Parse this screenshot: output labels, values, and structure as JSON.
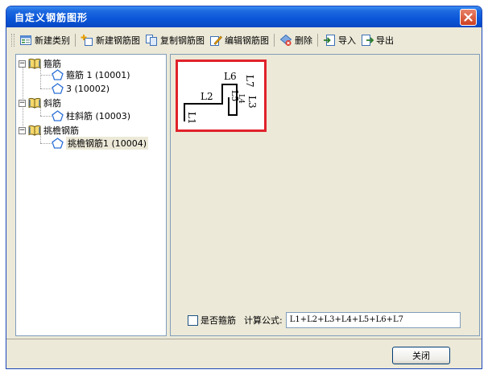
{
  "window": {
    "title": "自定义钢筋图形"
  },
  "toolbar": {
    "new_category": "新建类别",
    "new_figure": "新建钢筋图",
    "copy_figure": "复制钢筋图",
    "edit_figure": "编辑钢筋图",
    "delete": "删除",
    "import": "导入",
    "export": "导出"
  },
  "tree": {
    "categories": [
      {
        "label": "箍筋",
        "children": [
          "箍筋 1 (10001)",
          "3 (10002)"
        ]
      },
      {
        "label": "斜筋",
        "children": [
          "柱斜筋 (10003)"
        ]
      },
      {
        "label": "挑檐钢筋",
        "children": [
          "挑檐钢筋1 (10004)"
        ]
      }
    ],
    "expander_symbol": "−"
  },
  "preview": {
    "labels": [
      "L1",
      "L2",
      "L3",
      "L4",
      "L5",
      "L6",
      "L7"
    ]
  },
  "options": {
    "is_stirrup_label": "是否箍筋",
    "formula_label": "计算公式:",
    "formula_value": "L1+L2+L3+L4+L5+L6+L7"
  },
  "footer": {
    "close_label": "关闭"
  },
  "colors": {
    "title_bar": "#0A56D8",
    "preview_border": "#E0222A",
    "dialog_bg": "#ECE9D8"
  }
}
